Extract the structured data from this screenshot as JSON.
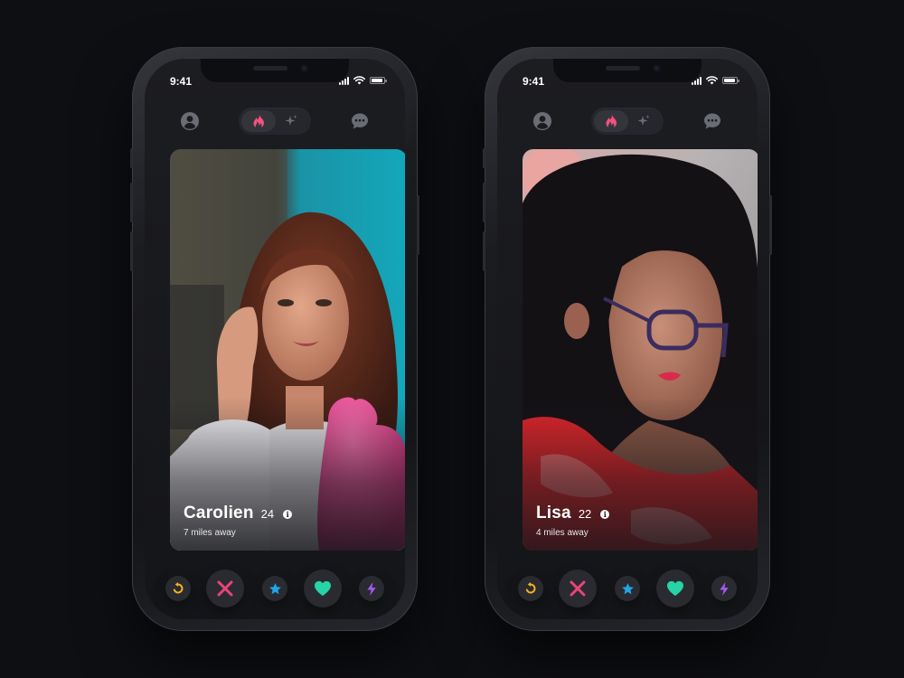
{
  "colors": {
    "background": "#0e0f13",
    "flame": "#f2527f",
    "rewind": "#f4b41a",
    "nope": "#e8457a",
    "super_like": "#20a6e8",
    "like": "#27d3a7",
    "boost": "#a45af0",
    "icon_muted": "#6b6d74"
  },
  "phones": [
    {
      "status": {
        "time": "9:41"
      },
      "topbar": {
        "left_icon": "profile-icon",
        "toggle_active": "flame-icon",
        "toggle_other": "sparkle-icon",
        "right_icon": "chat-bubble-icon"
      },
      "card": {
        "name": "Carolien",
        "age": "24",
        "info": "i",
        "distance": "7 miles away"
      },
      "actions": [
        "rewind-icon",
        "close-icon",
        "star-icon",
        "heart-icon",
        "bolt-icon"
      ]
    },
    {
      "status": {
        "time": "9:41"
      },
      "topbar": {
        "left_icon": "profile-icon",
        "toggle_active": "flame-icon",
        "toggle_other": "sparkle-icon",
        "right_icon": "chat-bubble-icon"
      },
      "card": {
        "name": "Lisa",
        "age": "22",
        "info": "i",
        "distance": "4 miles away"
      },
      "actions": [
        "rewind-icon",
        "close-icon",
        "star-icon",
        "heart-icon",
        "bolt-icon"
      ]
    }
  ]
}
